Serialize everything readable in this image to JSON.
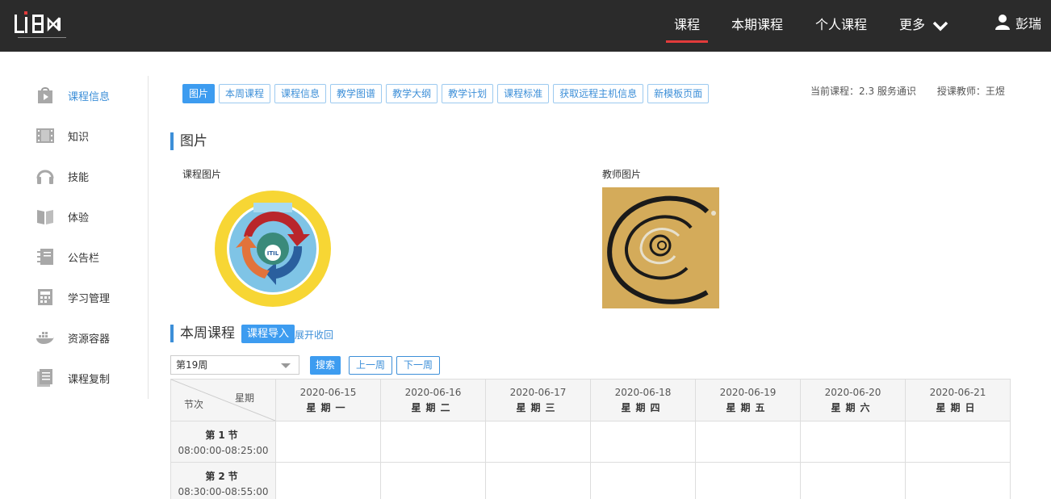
{
  "nav": {
    "items": [
      "课程",
      "本期课程",
      "个人课程",
      "更多"
    ],
    "user": "彭瑞"
  },
  "sidebar": {
    "items": [
      {
        "label": "课程信息",
        "icon": "play-bag-icon"
      },
      {
        "label": "知识",
        "icon": "film-icon"
      },
      {
        "label": "技能",
        "icon": "headphones-icon"
      },
      {
        "label": "体验",
        "icon": "book-icon"
      },
      {
        "label": "公告栏",
        "icon": "notebook-icon"
      },
      {
        "label": "学习管理",
        "icon": "calculator-icon"
      },
      {
        "label": "资源容器",
        "icon": "docker-icon"
      },
      {
        "label": "课程复制",
        "icon": "document-icon"
      }
    ]
  },
  "tabs": [
    "图片",
    "本周课程",
    "课程信息",
    "教学图谱",
    "教学大纲",
    "教学计划",
    "课程标准",
    "获取远程主机信息",
    "新模板页面"
  ],
  "course_info": {
    "current": "当前课程：2.3 服务通识",
    "teacher": "授课教师：王煜"
  },
  "pictures": {
    "title": "图片",
    "course_label": "课程图片",
    "teacher_label": "教师图片",
    "course_image_text": "ITIL"
  },
  "week": {
    "title": "本周课程",
    "import_button": "课程导入",
    "toggle_link": "展开收回",
    "selected_week": "第19周",
    "search": "搜索",
    "prev": "上一周",
    "next": "下一周"
  },
  "schedule": {
    "corner_day": "星期",
    "corner_section": "节次",
    "days": [
      {
        "date": "2020-06-15",
        "day": "星期一"
      },
      {
        "date": "2020-06-16",
        "day": "星期二"
      },
      {
        "date": "2020-06-17",
        "day": "星期三"
      },
      {
        "date": "2020-06-18",
        "day": "星期四"
      },
      {
        "date": "2020-06-19",
        "day": "星期五"
      },
      {
        "date": "2020-06-20",
        "day": "星期六"
      },
      {
        "date": "2020-06-21",
        "day": "星期日"
      }
    ],
    "slots": [
      {
        "name": "第1节",
        "time": "08:00:00-08:25:00"
      },
      {
        "name": "第2节",
        "time": "08:30:00-08:55:00"
      }
    ]
  },
  "colors": {
    "topbar": "#2b2b2b",
    "accent": "#3d8fd8",
    "active_underline": "#e23b3b"
  }
}
